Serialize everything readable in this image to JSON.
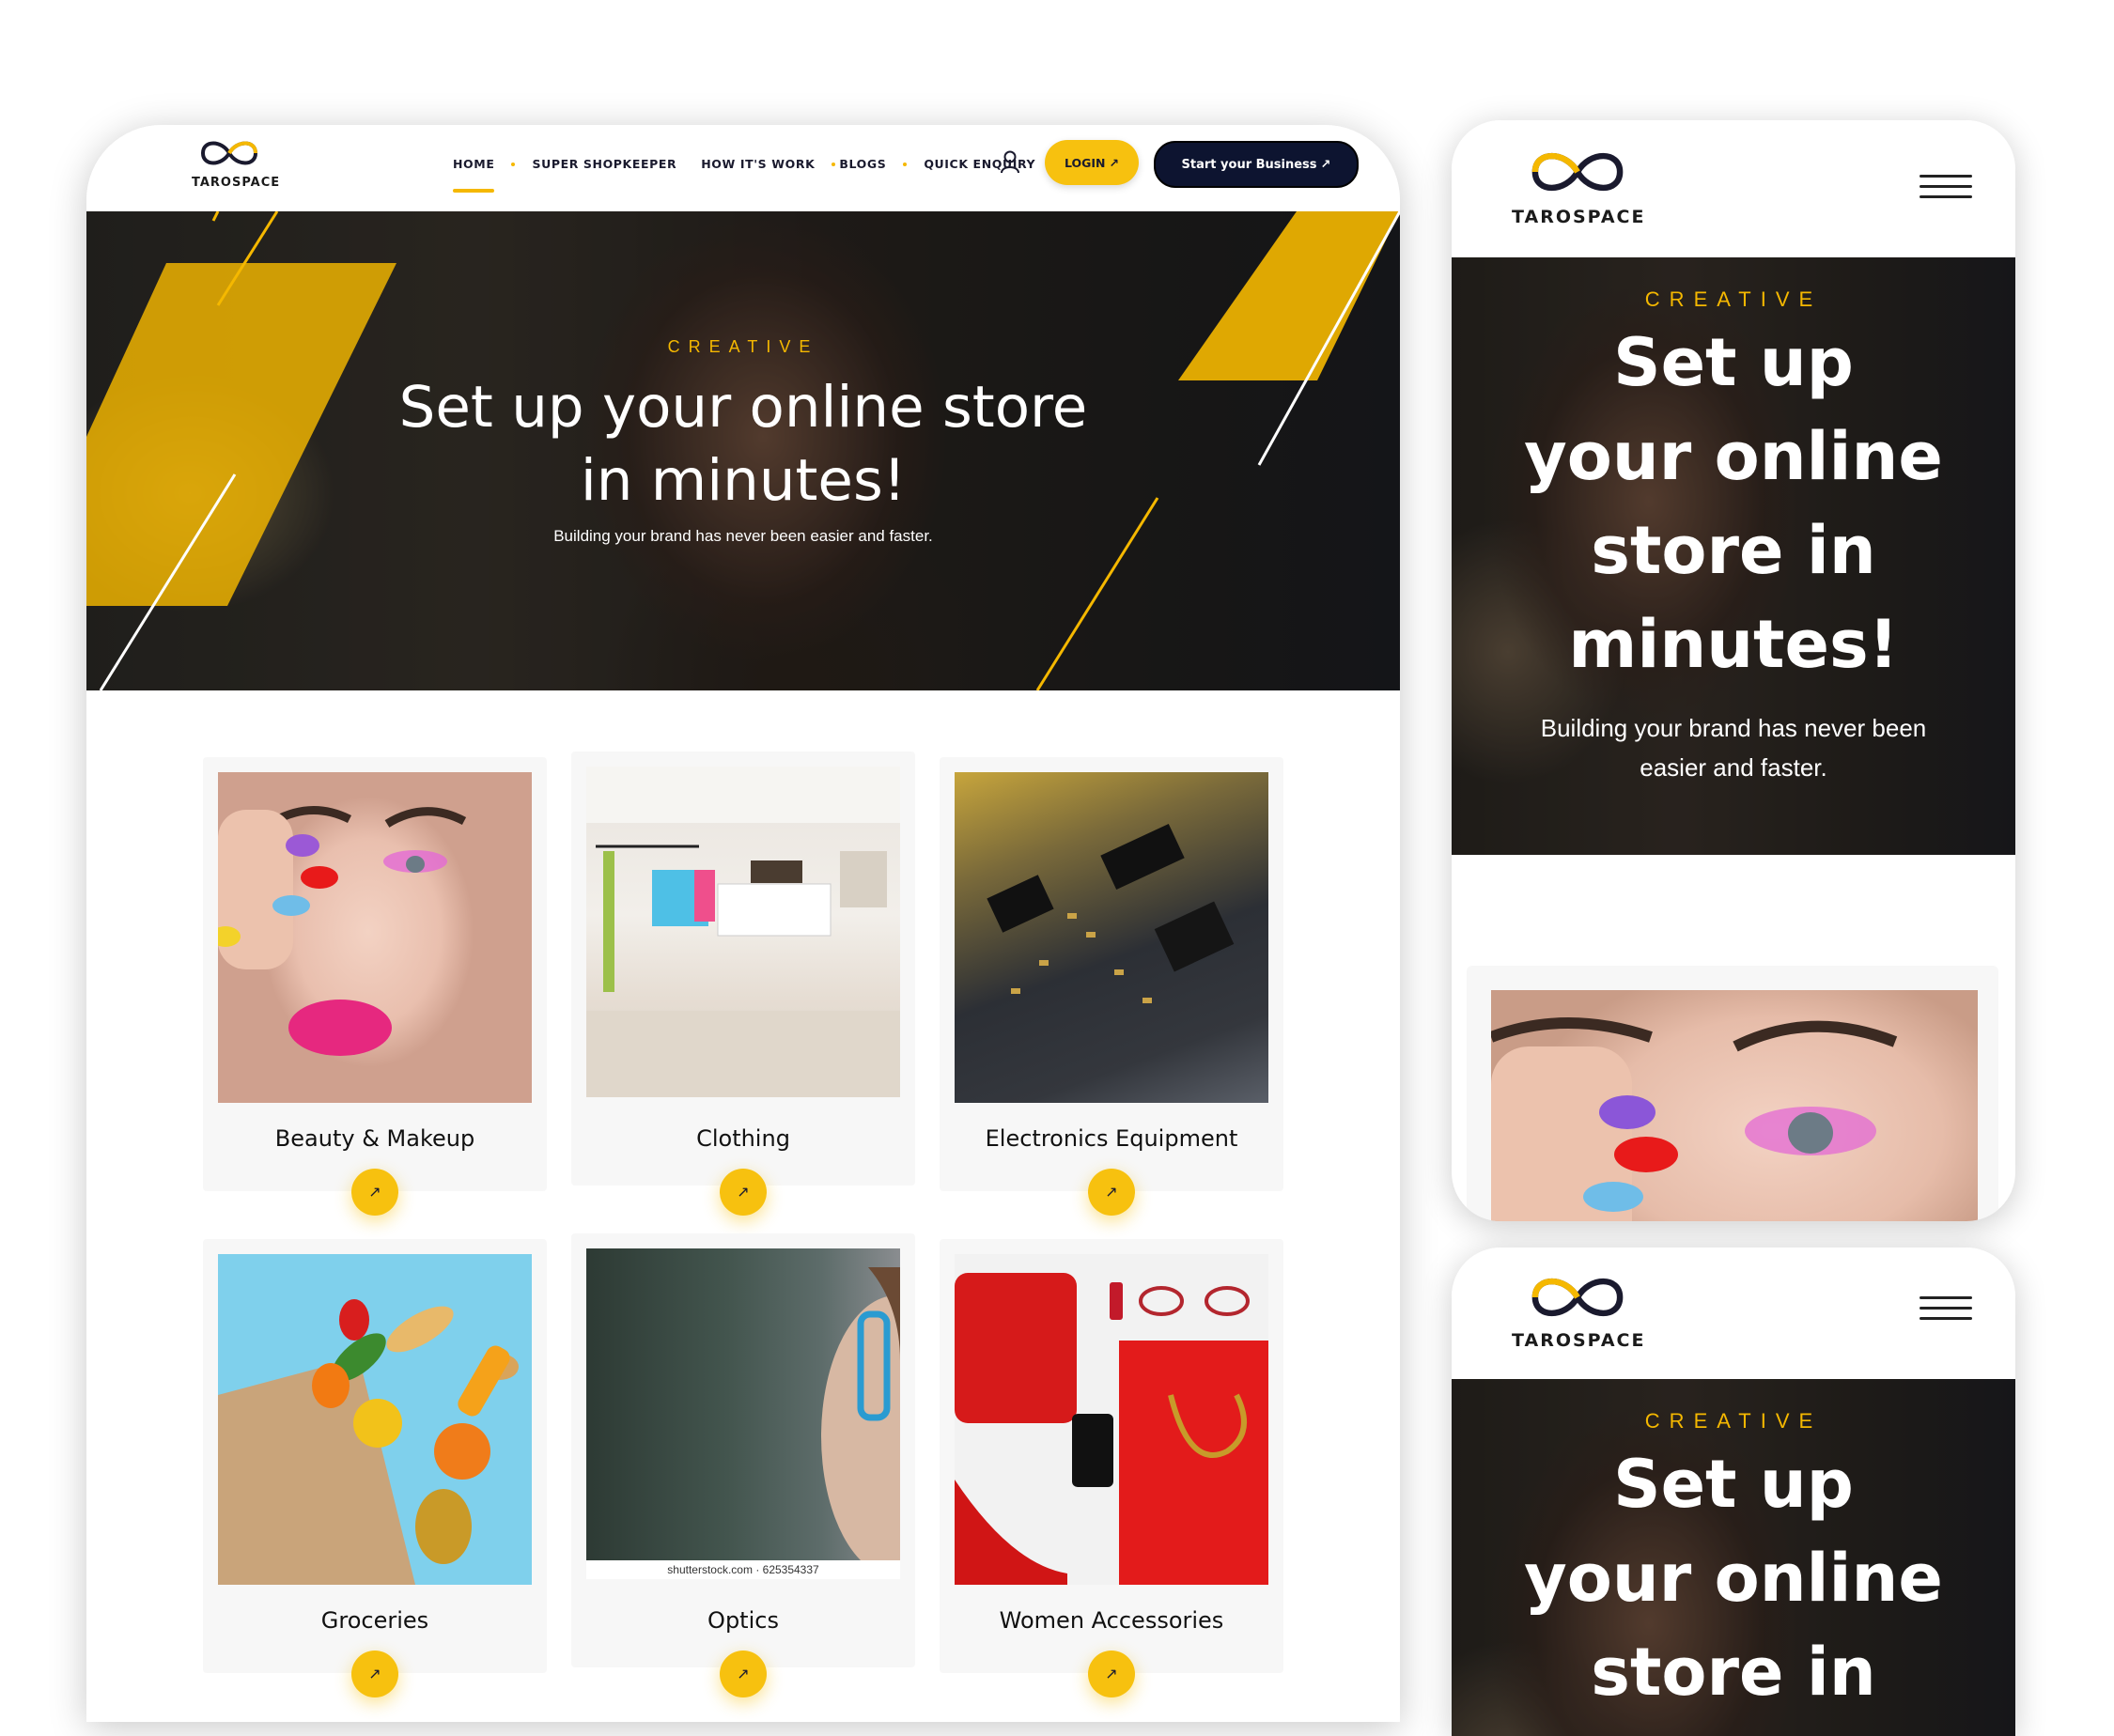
{
  "brand": {
    "name": "TAROSPACE"
  },
  "colors": {
    "accent": "#f7c10f",
    "dark": "#0d1430"
  },
  "desktop": {
    "nav": {
      "items": [
        {
          "label": "HOME",
          "active": true
        },
        {
          "label": "SUPER SHOPKEEPER"
        },
        {
          "label": "HOW IT'S WORK"
        },
        {
          "label": "BLOGS"
        },
        {
          "label": "QUICK ENQUIRY"
        }
      ],
      "user_icon": "user-icon",
      "login_label": "LOGIN",
      "start_label": "Start your Business",
      "arrow": "↗"
    },
    "hero": {
      "eyebrow": "CREATIVE",
      "title_line1": "Set up your online store",
      "title_line2": "in minutes!",
      "subtitle": "Building your brand has never been easier and faster."
    },
    "categories": [
      {
        "title": "Beauty & Makeup",
        "arrow": "↗"
      },
      {
        "title": "Clothing",
        "arrow": "↗"
      },
      {
        "title": "Electronics Equipment",
        "arrow": "↗"
      },
      {
        "title": "Groceries",
        "arrow": "↗"
      },
      {
        "title": "Optics",
        "arrow": "↗",
        "watermark": "shutterstock.com · 625354337"
      },
      {
        "title": "Women Accessories",
        "arrow": "↗"
      }
    ]
  },
  "mobile": {
    "menu_icon": "hamburger-icon",
    "hero": {
      "eyebrow": "CREATIVE",
      "line1": "Set up",
      "line2": "your online",
      "line3": "store in",
      "line4": "minutes!",
      "subtitle_line1": "Building your brand has never been",
      "subtitle_line2": "easier and faster."
    }
  }
}
